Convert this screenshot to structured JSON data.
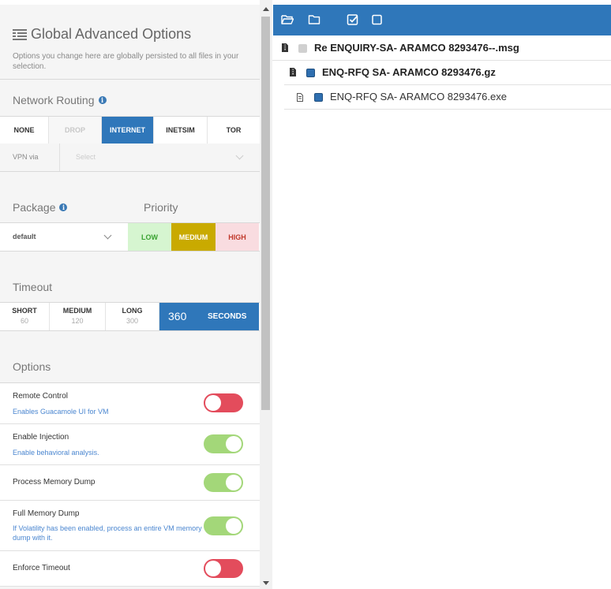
{
  "options_panel": {
    "title": "Global Advanced Options",
    "subtitle": "Options you change here are globally persisted to all files in your selection.",
    "network_routing": {
      "label": "Network Routing",
      "routes": [
        {
          "label": "NONE",
          "state": "normal"
        },
        {
          "label": "DROP",
          "state": "disabled"
        },
        {
          "label": "INTERNET",
          "state": "active"
        },
        {
          "label": "INETSIM",
          "state": "normal"
        },
        {
          "label": "TOR",
          "state": "normal"
        }
      ],
      "vpn_label": "VPN via",
      "vpn_placeholder": "Select"
    },
    "package": {
      "label": "Package",
      "value": "default"
    },
    "priority": {
      "label": "Priority",
      "options": [
        {
          "label": "LOW",
          "selected": false
        },
        {
          "label": "MEDIUM",
          "selected": true
        },
        {
          "label": "HIGH",
          "selected": false
        }
      ]
    },
    "timeout": {
      "label": "Timeout",
      "presets": [
        {
          "label": "SHORT",
          "value": "60"
        },
        {
          "label": "MEDIUM",
          "value": "120"
        },
        {
          "label": "LONG",
          "value": "300"
        }
      ],
      "custom_value": "360",
      "custom_unit": "SECONDS"
    },
    "options_label": "Options",
    "options": [
      {
        "name": "Remote Control",
        "desc": "Enables Guacamole UI for VM",
        "enabled": false
      },
      {
        "name": "Enable Injection",
        "desc": "Enable behavioral analysis.",
        "enabled": true
      },
      {
        "name": "Process Memory Dump",
        "desc": "",
        "enabled": true
      },
      {
        "name": "Full Memory Dump",
        "desc": "If Volatility has been enabled, process an entire VM memory dump with it.",
        "enabled": true
      },
      {
        "name": "Enforce Timeout",
        "desc": "",
        "enabled": false
      }
    ]
  },
  "file_tree": {
    "toolbar_icons": [
      "folder-open-icon",
      "folder-icon",
      "check-square-icon",
      "square-icon"
    ],
    "files": [
      {
        "name": "Re ENQUIRY-SA- ARAMCO 8293476--.msg",
        "bold": true,
        "checked": false
      },
      {
        "name": "ENQ-RFQ SA- ARAMCO 8293476.gz",
        "bold": true,
        "checked": true
      },
      {
        "name": "ENQ-RFQ SA- ARAMCO 8293476.exe",
        "bold": false,
        "checked": true
      }
    ]
  },
  "colors": {
    "accent": "#2f77ba",
    "low_bg": "#d6f5d0",
    "low_text": "#3aa231",
    "medium_bg": "#c9aa00",
    "high_bg": "#f9dce0",
    "high_text": "#c0392b",
    "toggle_on": "#a3d779",
    "toggle_off": "#e34c5c"
  }
}
